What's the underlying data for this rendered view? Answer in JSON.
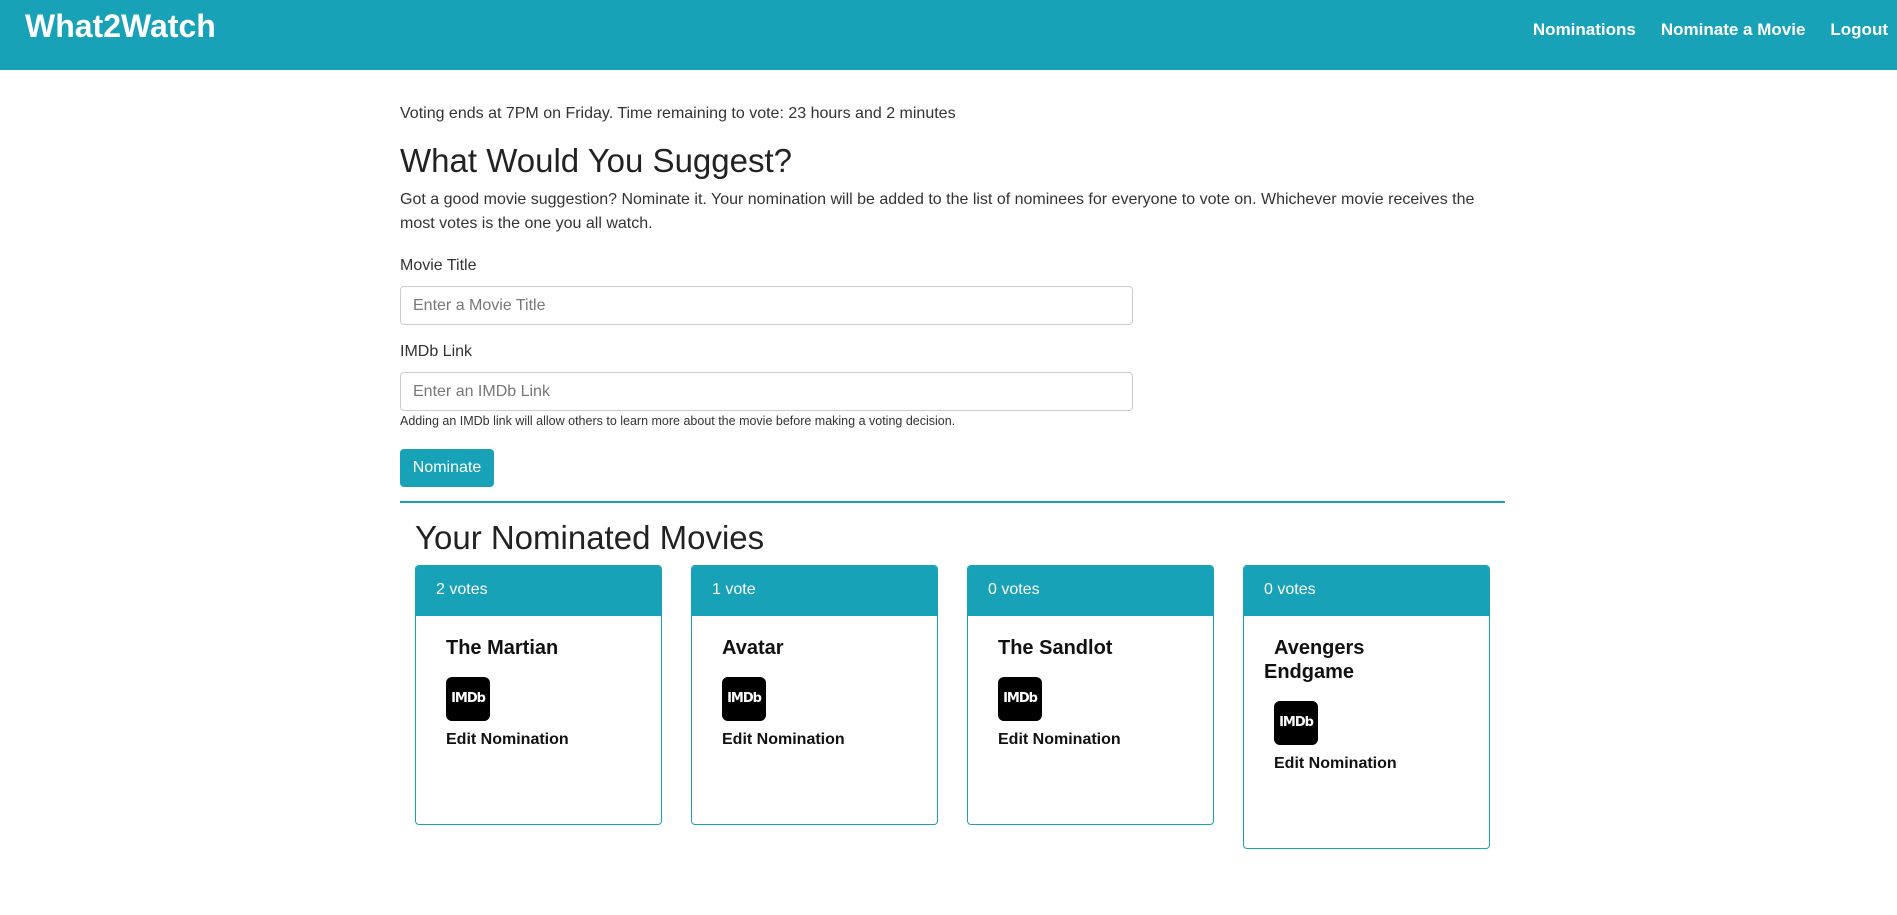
{
  "navbar": {
    "brand": "What2Watch",
    "links": [
      "Nominations",
      "Nominate a Movie",
      "Logout"
    ]
  },
  "deadline": "Voting ends at 7PM on Friday. Time remaining to vote: 23 hours and 2 minutes",
  "heading": "What Would You Suggest?",
  "description": "Got a good movie suggestion? Nominate it. Your nomination will be added to the list of nominees for everyone to vote on. Whichever movie receives the most votes is the one you all watch.",
  "form": {
    "title_label": "Movie Title",
    "title_placeholder": "Enter a Movie Title",
    "imdb_label": "IMDb Link",
    "imdb_placeholder": "Enter an IMDb Link",
    "help_text": "Adding an IMDb link will allow others to learn more about the movie before making a voting decision.",
    "submit_label": "Nominate"
  },
  "nominated": {
    "title": "Your Nominated Movies",
    "cards": [
      {
        "votes": "2 votes",
        "title": "The Martian",
        "imdb_label": "IMDb",
        "edit_label": "Edit Nomination"
      },
      {
        "votes": "1 vote",
        "title": "Avatar",
        "imdb_label": "IMDb",
        "edit_label": "Edit Nomination"
      },
      {
        "votes": "0 votes",
        "title": "The Sandlot",
        "imdb_label": "IMDb",
        "edit_label": "Edit Nomination"
      },
      {
        "votes": "0 votes",
        "title": "Avengers Endgame",
        "imdb_label": "IMDb",
        "edit_label": "Edit Nomination"
      }
    ]
  },
  "colors": {
    "accent": "#17a2b8"
  }
}
